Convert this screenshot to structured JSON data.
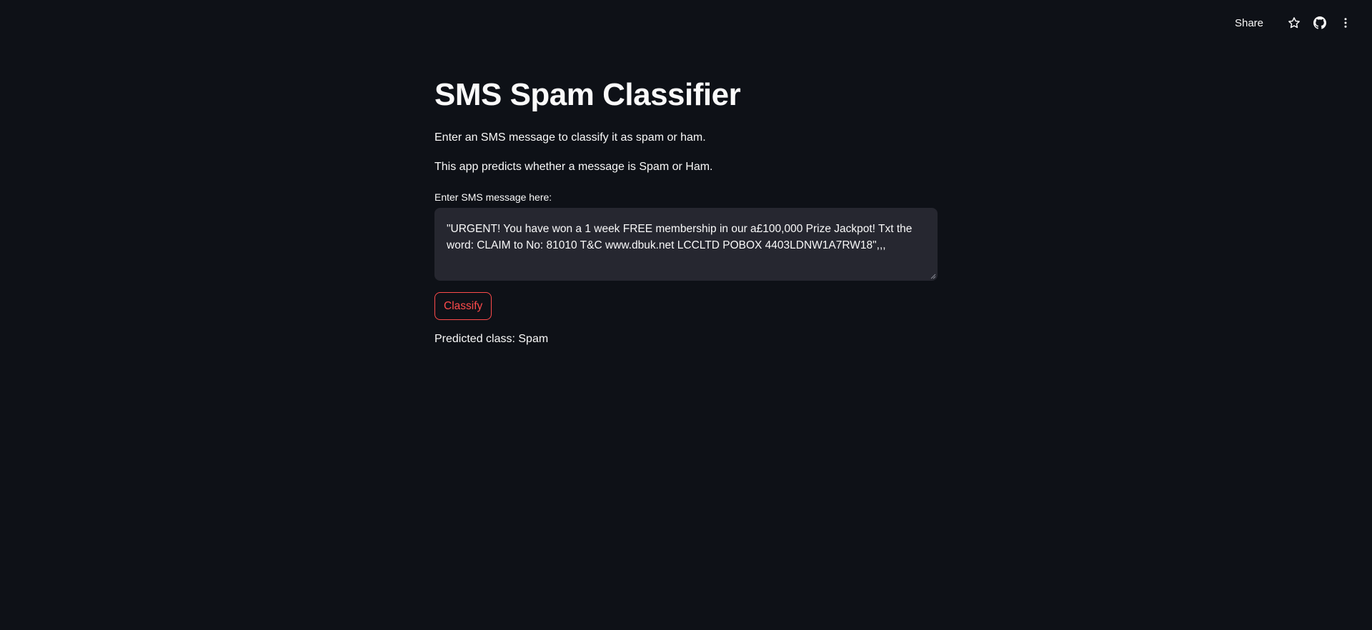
{
  "toolbar": {
    "share_label": "Share",
    "icons": [
      "star-icon",
      "github-icon",
      "more-vertical-icon"
    ]
  },
  "main": {
    "title": "SMS Spam Classifier",
    "intro": "Enter an SMS message to classify it as spam or ham.",
    "description": "This app predicts whether a message is Spam or Ham.",
    "input_label": "Enter SMS message here:",
    "input_value": "\"URGENT! You have won a 1 week FREE membership in our a£100,000 Prize Jackpot! Txt the word: CLAIM to No: 81010 T&C www.dbuk.net LCCLTD POBOX 4403LDNW1A7RW18\",,,",
    "button_label": "Classify",
    "result_text": "Predicted class: Spam"
  },
  "colors": {
    "background": "#0e1117",
    "text": "#fafafa",
    "input_bg": "#262730",
    "accent": "#ff4b4b"
  }
}
